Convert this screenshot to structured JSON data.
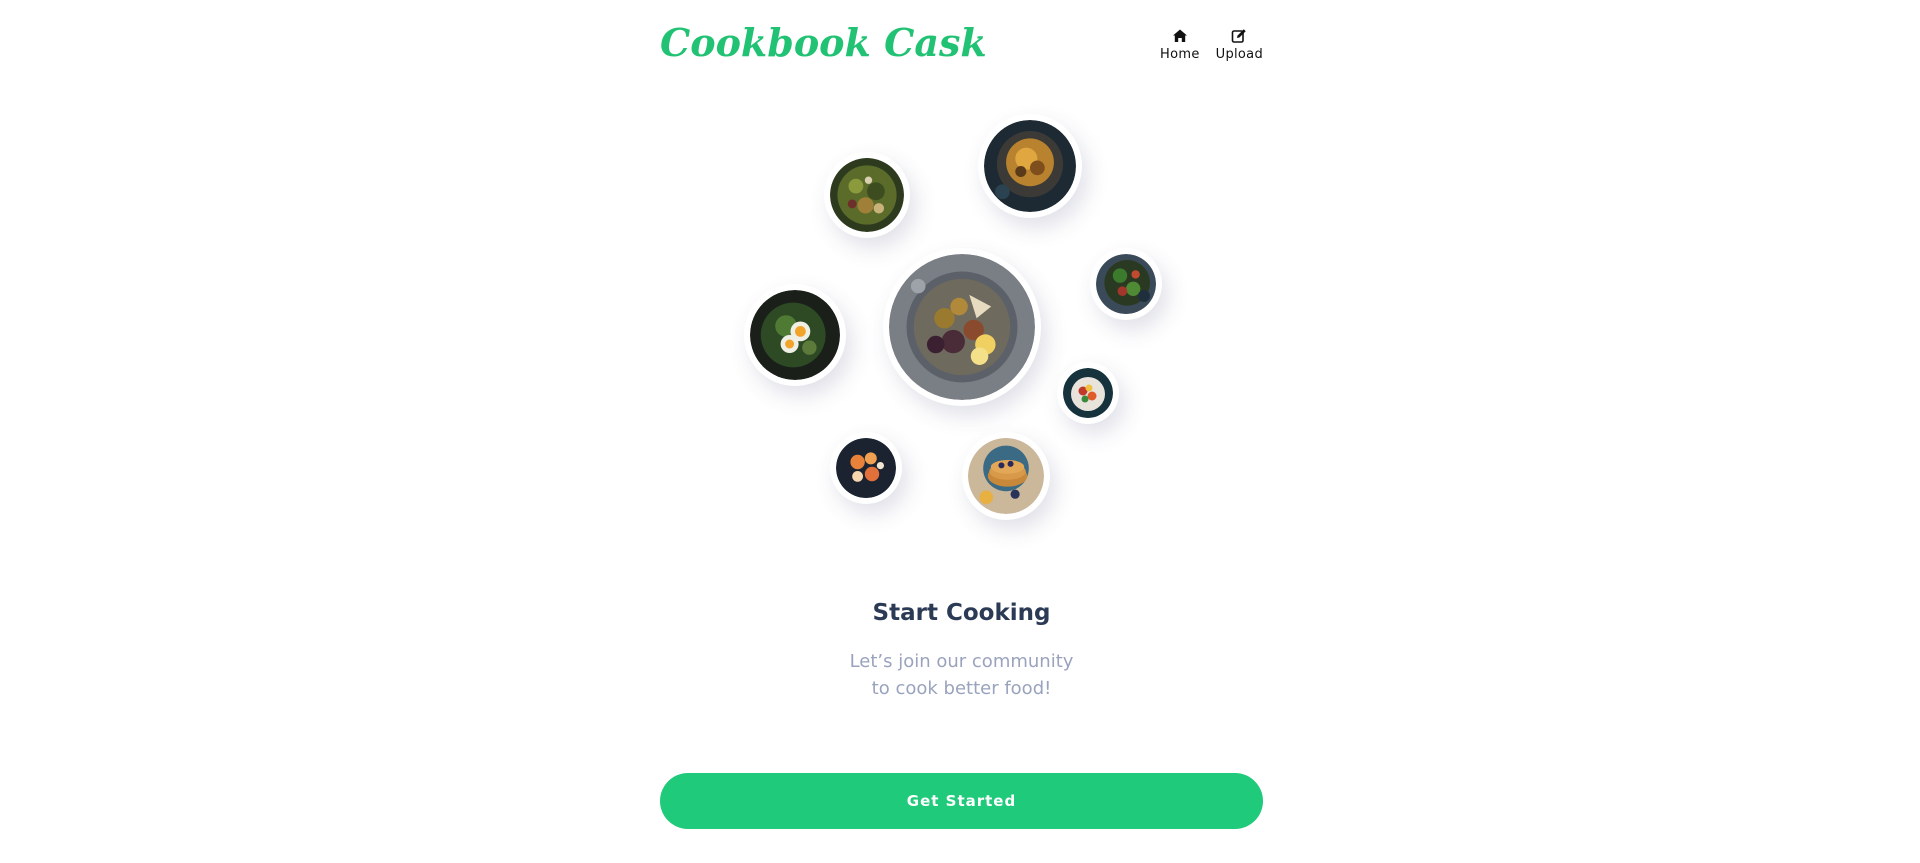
{
  "header": {
    "brand": "Cookbook Cask",
    "nav": [
      {
        "label": "Home",
        "icon": "home-icon"
      },
      {
        "label": "Upload",
        "icon": "edit-icon"
      }
    ]
  },
  "hero": {
    "title": "Start Cooking",
    "subtitle_line1": "Let’s join our community",
    "subtitle_line2": "to cook better food!"
  },
  "cta": {
    "label": "Get Started"
  },
  "colors": {
    "brand": "#22c274",
    "button": "#1fcb7a",
    "title": "#2b3a55",
    "subtitle": "#9aa3bd"
  },
  "plates": [
    {
      "name": "green-salad-photo"
    },
    {
      "name": "stew-pan-photo"
    },
    {
      "name": "greens-bowl-photo"
    },
    {
      "name": "platter-photo"
    },
    {
      "name": "egg-salad-photo"
    },
    {
      "name": "berry-salad-photo"
    },
    {
      "name": "shrimp-photo"
    },
    {
      "name": "pancakes-photo"
    }
  ]
}
